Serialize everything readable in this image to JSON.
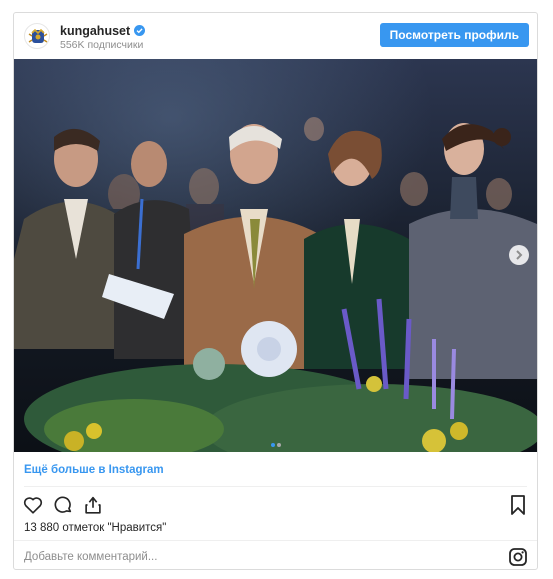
{
  "post": {
    "username": "kungahuset",
    "verified": true,
    "followers_text": "556K подписчики",
    "view_profile_label": "Посмотреть профиль",
    "more_on_instagram": "Ещё больше в Instagram",
    "likes_text": "13 880 отметок \"Нравится\"",
    "comment_placeholder": "Добавьте комментарий...",
    "carousel": {
      "total": 2,
      "current": 1
    }
  },
  "icons": {
    "avatar": "royal-crest-icon",
    "verified": "verified-badge-icon",
    "like": "heart-icon",
    "comment": "comment-bubble-icon",
    "share": "share-icon",
    "save": "bookmark-icon",
    "next": "chevron-right-icon",
    "instagram": "instagram-logo-icon"
  },
  "colors": {
    "accent": "#3897f0",
    "text": "#262626",
    "muted": "#8e8e8e",
    "border": "#dbdbdb"
  }
}
